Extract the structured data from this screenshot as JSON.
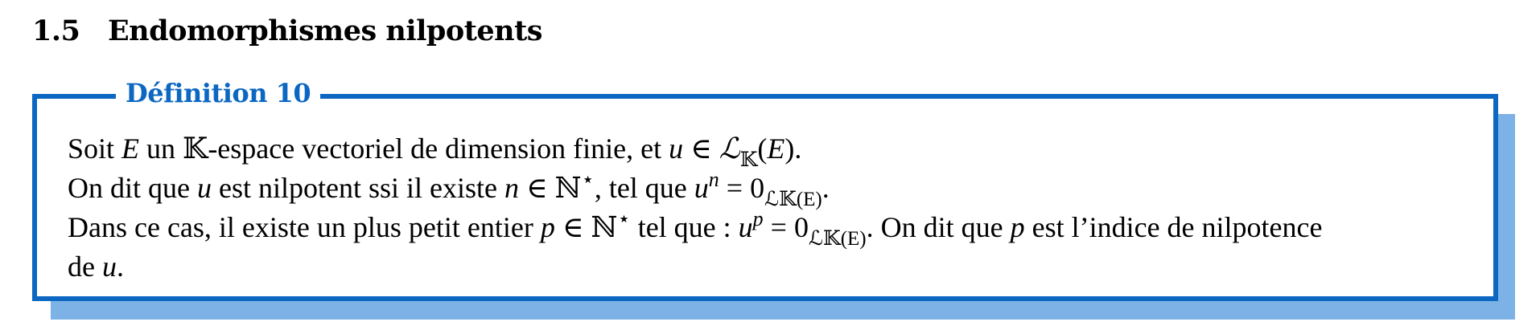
{
  "section": {
    "number": "1.5",
    "title": "Endomorphismes nilpotents"
  },
  "definition": {
    "title": "Définition 10",
    "border_color": "#0b67c2",
    "shadow_color": "#7cb2e6",
    "lines": [
      [
        {
          "t": "Soit "
        },
        {
          "t": "E",
          "s": "m"
        },
        {
          "t": " un 𝕂-espace vectoriel de dimension finie, et "
        },
        {
          "t": "u",
          "s": "m"
        },
        {
          "t": " ∈ "
        },
        {
          "t": "ℒ",
          "s": "scr"
        },
        {
          "t": "𝕂",
          "s": "sub"
        },
        {
          "t": "("
        },
        {
          "t": "E",
          "s": "m"
        },
        {
          "t": ")."
        }
      ],
      [
        {
          "t": "On dit que "
        },
        {
          "t": "u",
          "s": "m"
        },
        {
          "t": " est nilpotent ssi il existe "
        },
        {
          "t": "n",
          "s": "m"
        },
        {
          "t": " ∈ ℕ"
        },
        {
          "t": "⋆",
          "s": "sup"
        },
        {
          "t": ", tel que "
        },
        {
          "t": "u",
          "s": "m"
        },
        {
          "t": "n",
          "s": "sup m"
        },
        {
          "t": " = 0"
        },
        {
          "t": "ℒ𝕂(E)",
          "s": "sub"
        },
        {
          "t": "."
        }
      ],
      [
        {
          "t": "Dans ce cas, il existe un plus petit entier "
        },
        {
          "t": "p",
          "s": "m"
        },
        {
          "t": " ∈ ℕ"
        },
        {
          "t": "⋆",
          "s": "sup"
        },
        {
          "t": " tel que : "
        },
        {
          "t": "u",
          "s": "m"
        },
        {
          "t": "p",
          "s": "sup m"
        },
        {
          "t": " = 0"
        },
        {
          "t": "ℒ𝕂(E)",
          "s": "sub"
        },
        {
          "t": ". On dit que "
        },
        {
          "t": "p",
          "s": "m"
        },
        {
          "t": " est l’indice de nilpotence"
        }
      ],
      [
        {
          "t": "de "
        },
        {
          "t": "u",
          "s": "m"
        },
        {
          "t": "."
        }
      ]
    ]
  }
}
